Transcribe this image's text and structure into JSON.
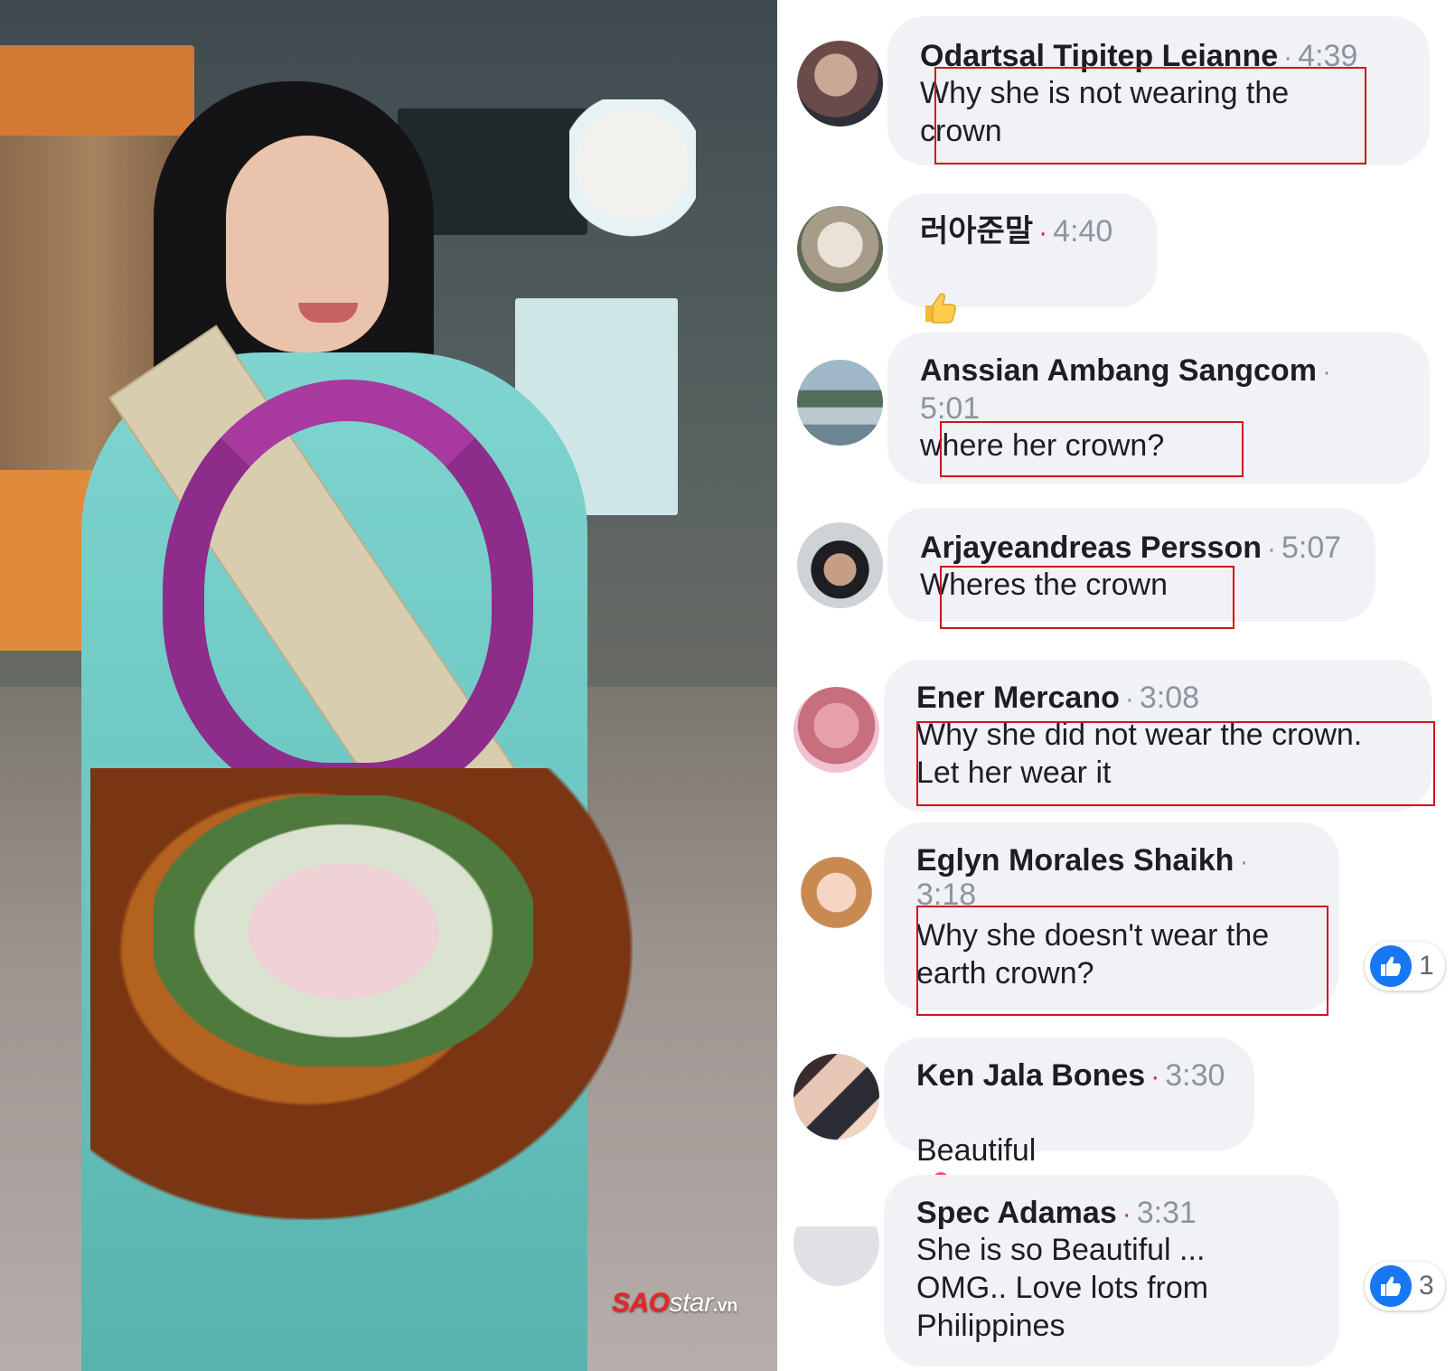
{
  "photo": {
    "watermark": {
      "sao": "SAO",
      "star": "star",
      "tld": ".vn"
    }
  },
  "comments": [
    {
      "name": "Odartsal Tipitep Leianne",
      "time": "4:39",
      "text": "Why she is not wearing the\ncrown"
    },
    {
      "name": "러아준말",
      "time": "4:40",
      "text": ""
    },
    {
      "name": "Anssian Ambang Sangcom",
      "time": "5:01",
      "text": "where her crown?"
    },
    {
      "name": "Arjayeandreas Persson",
      "time": "5:07",
      "text": "Wheres the crown"
    },
    {
      "name": "Ener Mercano",
      "time": "3:08",
      "text": "Why she did not wear the crown.\nLet her wear it"
    },
    {
      "name": "Eglyn Morales Shaikh",
      "time": "3:18",
      "text": "Why she doesn't wear the\nearth crown?",
      "reactions": "1"
    },
    {
      "name": "Ken Jala Bones",
      "time": "3:30",
      "text": "Beautiful"
    },
    {
      "name": "Spec Adamas",
      "time": "3:31",
      "text": "She is so Beautiful ...\nOMG.. Love lots from\nPhilippines",
      "reactions": "3"
    }
  ],
  "separator": "·",
  "colors": {
    "bubble": "#f0f2f5",
    "highlight": "#d0141b",
    "like": "#1877f2",
    "meta": "#8d949e"
  }
}
